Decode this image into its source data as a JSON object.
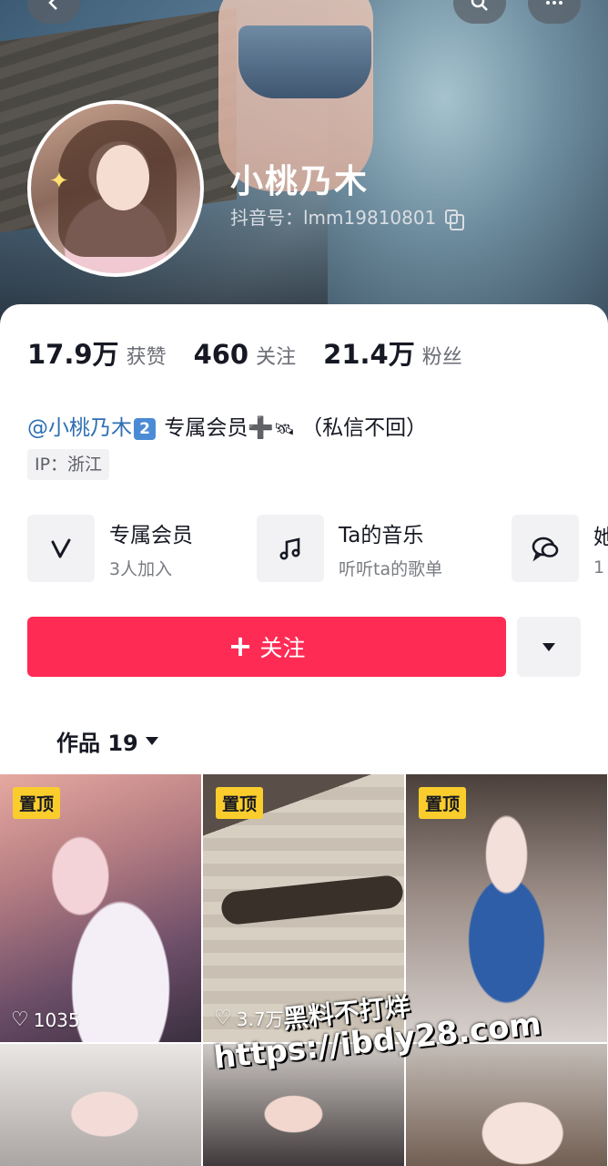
{
  "profile": {
    "name": "小桃乃木",
    "douyin_id": "抖音号：lmm19810801"
  },
  "stats": [
    {
      "value": "17.9万",
      "label": "获赞"
    },
    {
      "value": "460",
      "label": "关注"
    },
    {
      "value": "21.4万",
      "label": "粉丝"
    }
  ],
  "bio": {
    "mention": "@小桃乃木",
    "badge": "2",
    "text": "专属会员",
    "plus": "➕",
    "satellite": "🛰",
    "note": "（私信不回）"
  },
  "ip": "IP：浙江",
  "features": [
    {
      "icon": "v-logo-icon",
      "glyph": "V",
      "title": "专属会员",
      "sub": "3人加入"
    },
    {
      "icon": "music-note-icon",
      "glyph": "♫",
      "title": "Ta的音乐",
      "sub": "听听ta的歌单"
    },
    {
      "icon": "chat-bubble-icon",
      "glyph": "◌",
      "title": "她",
      "sub": "1"
    }
  ],
  "actions": {
    "follow_label": "关注",
    "follow_plus": "+"
  },
  "tabs": {
    "works_label": "作品 19"
  },
  "posts": [
    {
      "pinned": "置顶",
      "likes": "1035"
    },
    {
      "pinned": "置顶",
      "likes": "3.7万"
    },
    {
      "pinned": "置顶",
      "likes": ""
    },
    {
      "pinned": "",
      "likes": ""
    },
    {
      "pinned": "",
      "likes": ""
    },
    {
      "pinned": "",
      "likes": ""
    }
  ],
  "watermark": {
    "line1": "黑料不打烊",
    "line2": "https://ibdy28.com"
  },
  "colors": {
    "accent": "#fe2c55",
    "pin": "#facd2d",
    "mention": "#2e6fb3"
  }
}
